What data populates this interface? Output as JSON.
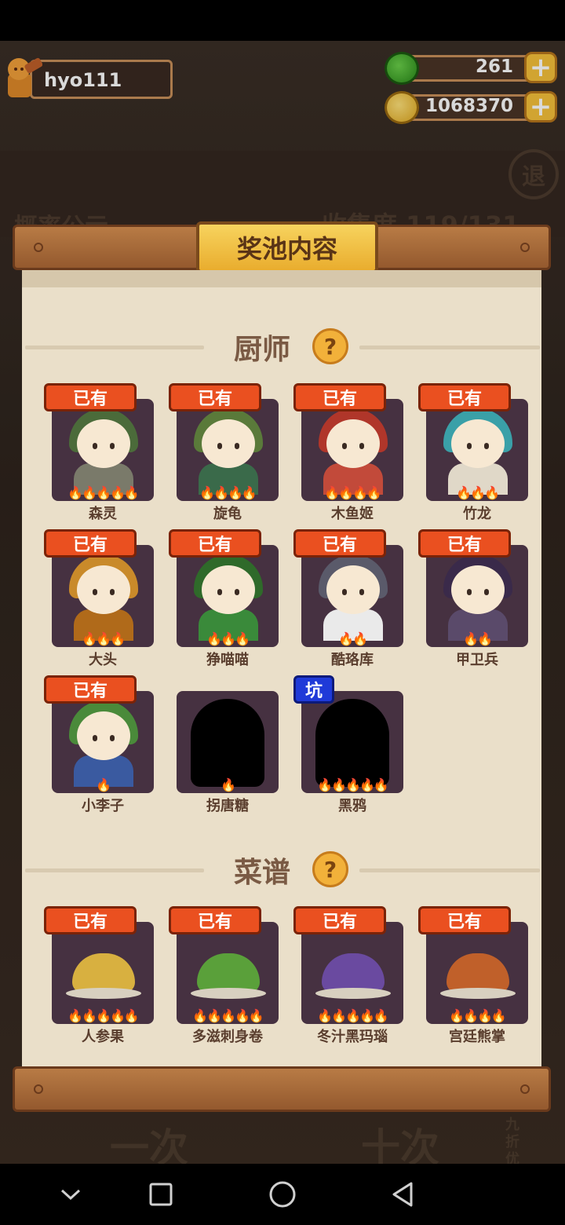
{
  "player": {
    "name": "hyo111"
  },
  "resources": [
    {
      "name": "jade",
      "value": "261",
      "icon": "jade-icon",
      "color": "#3fae2a"
    },
    {
      "name": "coins",
      "value": "1068370",
      "icon": "coin-icon",
      "color": "#f2c230"
    }
  ],
  "background": {
    "ghost_left": "概率公示",
    "ghost_right": "收集度 119/131",
    "exit": "退",
    "btn1": "一次",
    "btn10": "十次",
    "discount": "九折优惠"
  },
  "dialog": {
    "title": "奖池内容",
    "sections": [
      {
        "title": "厨师",
        "help_icon": "question-icon",
        "items": [
          {
            "name": "森灵",
            "badge": "已有",
            "flames": "🔥🔥🔥🔥🔥",
            "color": "#4b6b3a",
            "body": "#7a7a6a"
          },
          {
            "name": "旋龟",
            "badge": "已有",
            "flames": "🔥🔥🔥🔥",
            "color": "#5a7a3a",
            "body": "#3a6a4a"
          },
          {
            "name": "木鱼姬",
            "badge": "已有",
            "flames": "🔥🔥🔥🔥",
            "color": "#b0362a",
            "body": "#c24a3a"
          },
          {
            "name": "竹龙",
            "badge": "已有",
            "flames": "🔥🔥🔥",
            "color": "#3aa0a8",
            "body": "#e0d8c8"
          },
          {
            "name": "大头",
            "badge": "已有",
            "flames": "🔥🔥🔥",
            "color": "#c98a2a",
            "body": "#b06a1a"
          },
          {
            "name": "狰喵喵",
            "badge": "已有",
            "flames": "🔥🔥🔥",
            "color": "#2f6a2a",
            "body": "#3a8a3a"
          },
          {
            "name": "酷珞库",
            "badge": "已有",
            "flames": "🔥🔥",
            "color": "#5a5a6a",
            "body": "#eaeaea"
          },
          {
            "name": "甲卫兵",
            "badge": "已有",
            "flames": "🔥🔥",
            "color": "#3a2a4a",
            "body": "#5a4a6a"
          },
          {
            "name": "小李子",
            "badge": "已有",
            "flames": "🔥",
            "color": "#4a8a3a",
            "body": "#3a5aa0"
          },
          {
            "name": "拐唐糖",
            "badge": "",
            "flames": "🔥",
            "color": "#000000",
            "body": "#000000",
            "silhouette": true
          },
          {
            "name": "黑鸦",
            "badge": "坑",
            "badge_color": "blue",
            "flames": "🔥🔥🔥🔥🔥",
            "color": "#000000",
            "body": "#000000",
            "silhouette": true
          }
        ]
      },
      {
        "title": "菜谱",
        "help_icon": "question-icon",
        "items": [
          {
            "name": "人参果",
            "badge": "已有",
            "flames": "🔥🔥🔥🔥🔥",
            "color": "#d8b040"
          },
          {
            "name": "多滋刺身卷",
            "badge": "已有",
            "flames": "🔥🔥🔥🔥🔥",
            "color": "#5aa03a"
          },
          {
            "name": "冬汁黑玛瑙",
            "badge": "已有",
            "flames": "🔥🔥🔥🔥🔥",
            "color": "#6a4aa0"
          },
          {
            "name": "宫廷熊掌",
            "badge": "已有",
            "flames": "🔥🔥🔥🔥",
            "color": "#c0602a"
          }
        ]
      }
    ]
  },
  "navbar": {
    "back_icon": "back-triangle-icon",
    "home_icon": "home-circle-icon",
    "recents_icon": "recents-square-icon",
    "collapse_icon": "chevron-down-icon"
  }
}
